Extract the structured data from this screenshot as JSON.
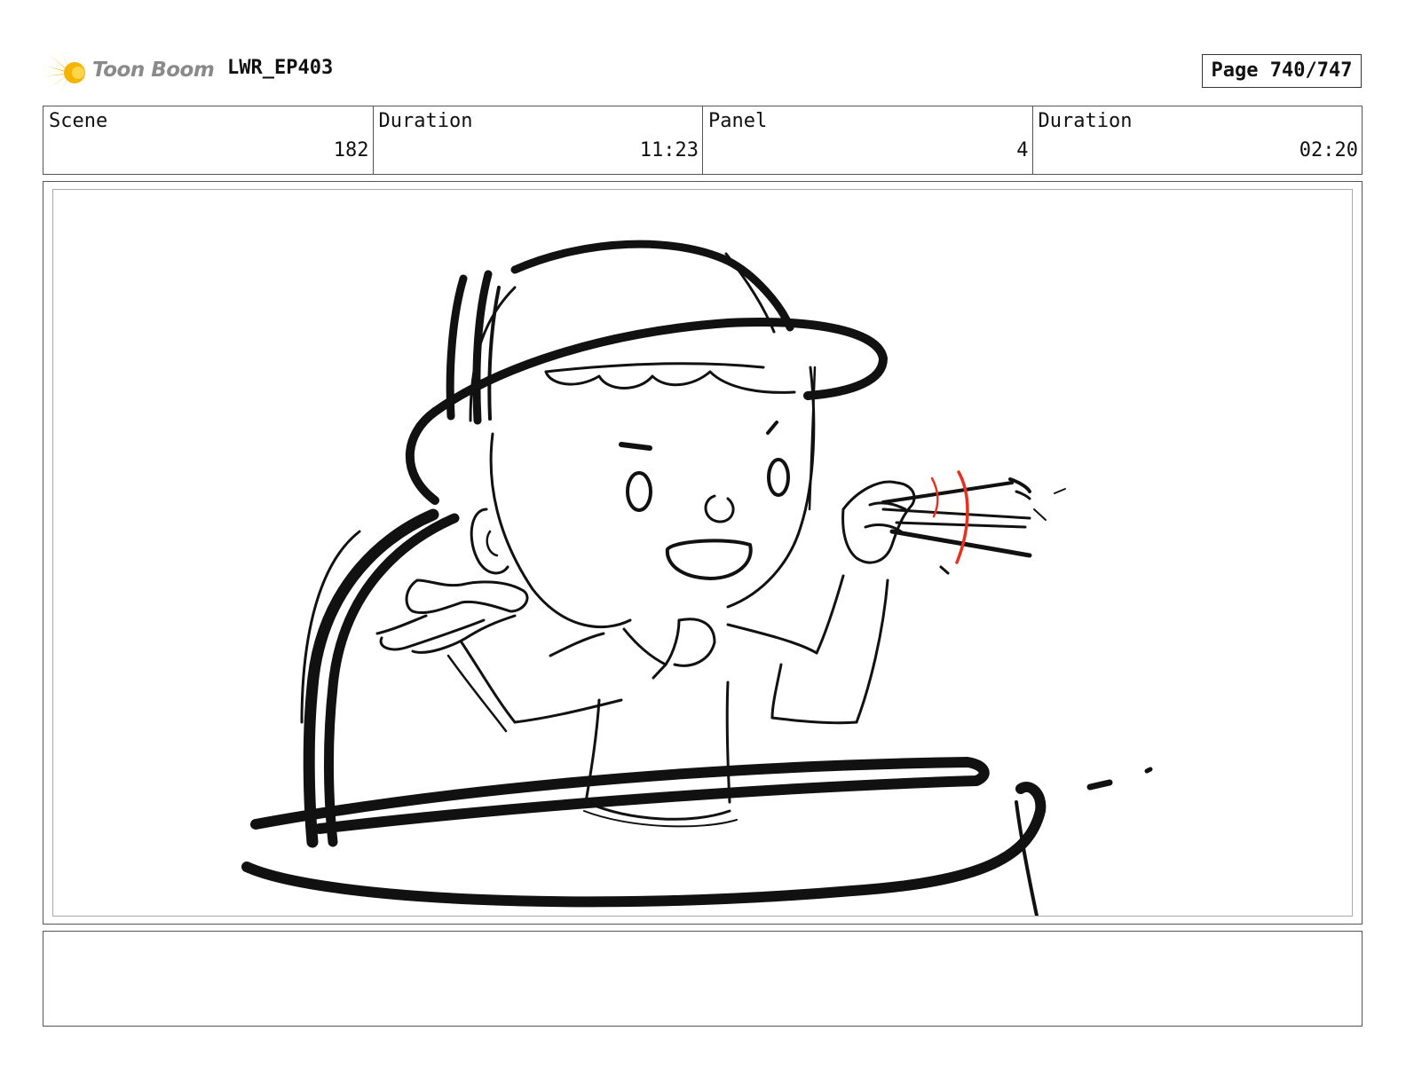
{
  "header": {
    "brand": "Toon Boom",
    "project_id": "LWR_EP403",
    "page_label": "Page 740/747"
  },
  "info": {
    "scene_label": "Scene",
    "scene_value": "182",
    "scene_duration_label": "Duration",
    "scene_duration_value": "11:23",
    "panel_label": "Panel",
    "panel_value": "4",
    "panel_duration_label": "Duration",
    "panel_duration_value": "02:20"
  },
  "colors": {
    "logo_yellow": "#f5b400",
    "logo_text": "#8a8a8a",
    "sketch_ink": "#111111",
    "motion_accent": "#e8321e"
  },
  "notes": {
    "text": ""
  }
}
